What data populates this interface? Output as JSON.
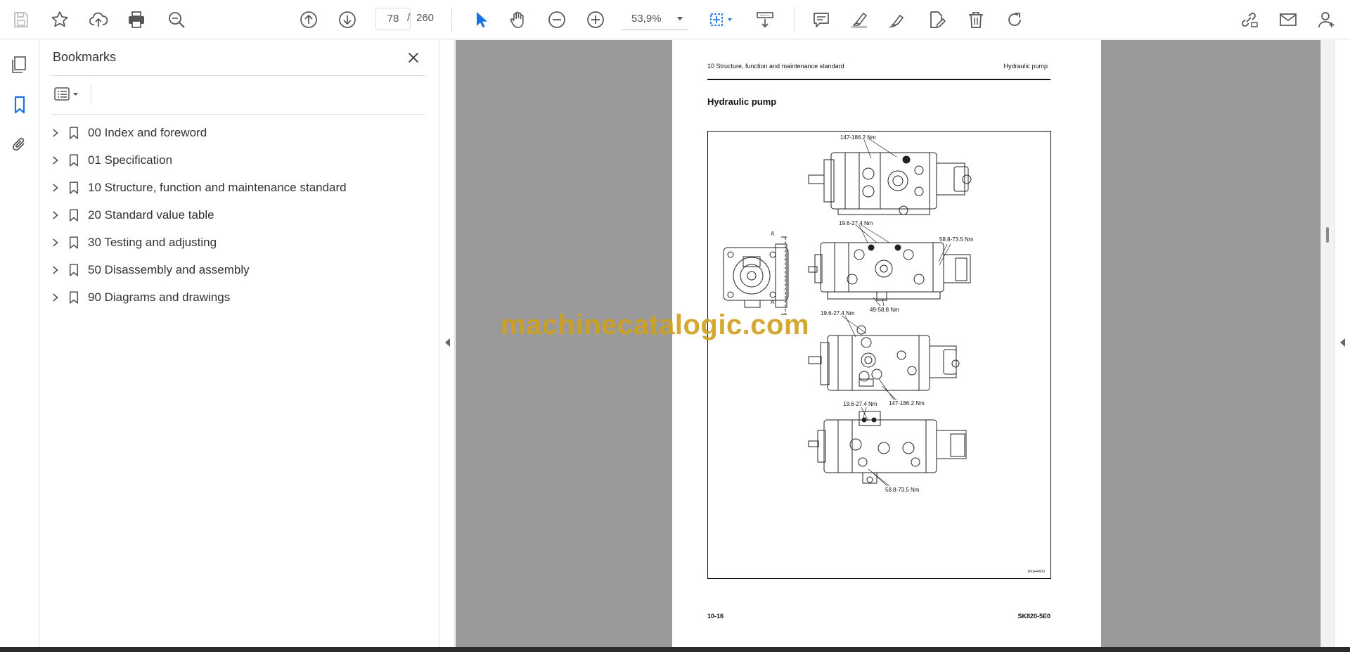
{
  "toolbar": {
    "page_current": "78",
    "page_separator": "/",
    "page_total": "260",
    "zoom_value": "53,9%",
    "accent_color": "#1473e6"
  },
  "left_rail": {
    "icons": [
      "pages-icon",
      "bookmark-icon",
      "attachment-icon"
    ]
  },
  "bookmarks_panel": {
    "title": "Bookmarks",
    "items": [
      {
        "label": "00 Index and foreword"
      },
      {
        "label": "01 Specification"
      },
      {
        "label": "10 Structure, function and maintenance standard"
      },
      {
        "label": "20 Standard value table"
      },
      {
        "label": "30 Testing and adjusting"
      },
      {
        "label": "50 Disassembly and assembly"
      },
      {
        "label": "90 Diagrams and drawings"
      }
    ]
  },
  "document": {
    "header_left": "10 Structure, function and maintenance standard",
    "header_right": "Hydraulic pump",
    "title": "Hydraulic pump",
    "figure_labels": {
      "l1": "147-186.2 Nm",
      "l2": "19.6-27.4 Nm",
      "l3": "58.8-73.5 Nm",
      "l4": "A",
      "l5": "A",
      "l6": "49-58.8 Nm",
      "l7": "19.6-27.4 Nm",
      "l8": "19.6-27.4 Nm",
      "l9": "147-186.2 Nm",
      "l10": "58.8-73.5 Nm",
      "code": "RKA44600"
    },
    "footer_left": "10-16",
    "footer_right": "SK820-5E0"
  },
  "watermark": "machinecatalogic.com"
}
